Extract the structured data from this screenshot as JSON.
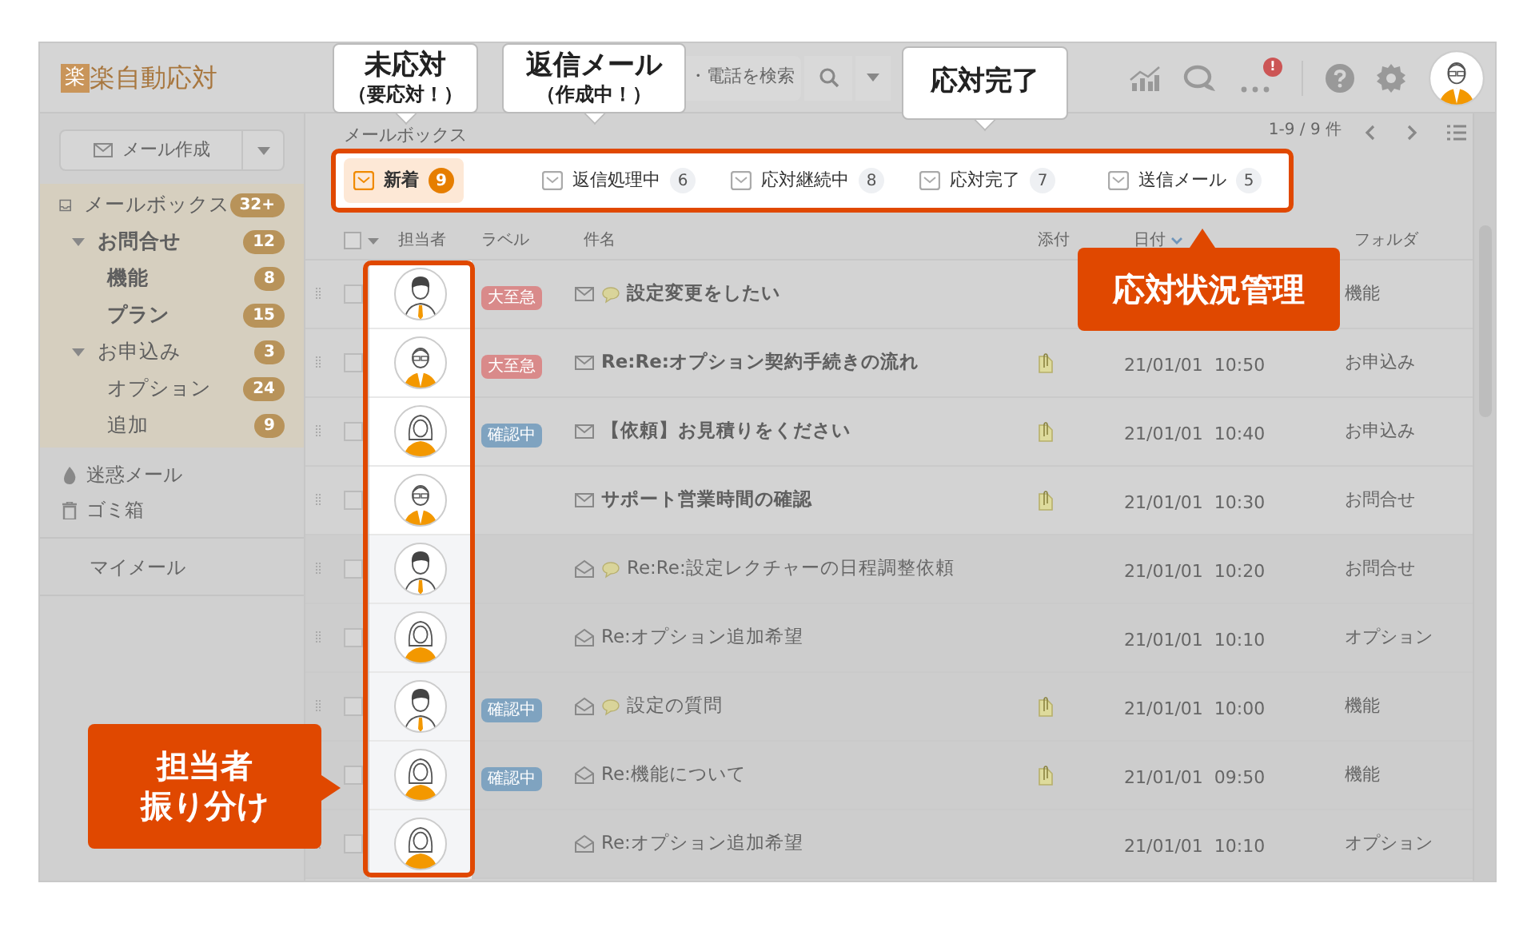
{
  "header": {
    "logo_mark": "楽",
    "logo_text": "楽自動応対",
    "search_visible_text": "・電話を検索",
    "alert_badge": "!"
  },
  "sidebar": {
    "compose_button": "メール作成",
    "tree": [
      {
        "label": "メールボックス",
        "count": "32+",
        "bold": false,
        "children": [
          {
            "label": "お問合せ",
            "count": "12",
            "bold": true,
            "expanded": true,
            "children": [
              {
                "label": "機能",
                "count": "8",
                "bold": true
              },
              {
                "label": "プラン",
                "count": "15",
                "bold": true
              }
            ]
          },
          {
            "label": "お申込み",
            "count": "3",
            "bold": false,
            "expanded": true,
            "children": [
              {
                "label": "オプション",
                "count": "24",
                "bold": false
              },
              {
                "label": "追加",
                "count": "9",
                "bold": false
              }
            ]
          }
        ]
      }
    ],
    "other_items": [
      {
        "label": "迷惑メール",
        "kind": "spam"
      },
      {
        "label": "ゴミ箱",
        "kind": "trash"
      }
    ],
    "my_mail": "マイメール"
  },
  "main": {
    "section_title": "メールボックス",
    "pagination": "1-9 / 9 件",
    "tabs": [
      {
        "label": "新着",
        "count": "9",
        "selected": true
      },
      {
        "label": "返信処理中",
        "count": "6",
        "selected": false
      },
      {
        "label": "応対継続中",
        "count": "8",
        "selected": false
      },
      {
        "label": "応対完了",
        "count": "7",
        "selected": false
      },
      {
        "label": "送信メール",
        "count": "5",
        "selected": false
      }
    ],
    "table": {
      "select_all_checked": false,
      "columns": [
        "担当者",
        "ラベル",
        "件名",
        "添付",
        "日付",
        "フォルダ"
      ],
      "rows": [
        {
          "assignee": {
            "kind": "man"
          },
          "label": {
            "text": "大至急",
            "color": "#d98a8a"
          },
          "opened": false,
          "comment": true,
          "unread": true,
          "subject": "設定変更をしたい",
          "attachment": false,
          "folder": "機能"
        },
        {
          "assignee": {
            "kind": "man-glasses"
          },
          "label": {
            "text": "大至急",
            "color": "#d98a8a"
          },
          "opened": false,
          "comment": false,
          "unread": true,
          "subject": "Re:Re:オプション契約手続きの流れ",
          "attachment": true,
          "date": "21/01/01  10:50",
          "folder": "お申込み"
        },
        {
          "assignee": {
            "kind": "woman"
          },
          "label": {
            "text": "確認中",
            "color": "#7fa3c0"
          },
          "opened": false,
          "comment": false,
          "unread": true,
          "subject": "【依頼】お見積りをください",
          "attachment": true,
          "date": "21/01/01  10:40",
          "folder": "お申込み"
        },
        {
          "assignee": {
            "kind": "man-glasses"
          },
          "opened": false,
          "comment": false,
          "unread": true,
          "subject": "サポート営業時間の確認",
          "attachment": true,
          "date": "21/01/01  10:30",
          "folder": "お問合せ"
        },
        {
          "assignee": {
            "kind": "man"
          },
          "opened": true,
          "comment": true,
          "unread": false,
          "subject": "Re:Re:設定レクチャーの日程調整依頼",
          "attachment": false,
          "date": "21/01/01  10:20",
          "folder": "お問合せ"
        },
        {
          "assignee": {
            "kind": "woman"
          },
          "opened": true,
          "comment": false,
          "unread": false,
          "subject": "Re:オプション追加希望",
          "attachment": false,
          "date": "21/01/01  10:10",
          "folder": "オプション"
        },
        {
          "assignee": {
            "kind": "man"
          },
          "label": {
            "text": "確認中",
            "color": "#7fa3c0"
          },
          "opened": true,
          "comment": true,
          "unread": false,
          "subject": "設定の質問",
          "attachment": true,
          "date": "21/01/01  10:00",
          "folder": "機能"
        },
        {
          "assignee": {
            "kind": "woman"
          },
          "label": {
            "text": "確認中",
            "color": "#7fa3c0"
          },
          "opened": true,
          "comment": false,
          "unread": false,
          "subject": "Re:機能について",
          "attachment": true,
          "date": "21/01/01  09:50",
          "folder": "機能"
        },
        {
          "assignee": {
            "kind": "woman"
          },
          "opened": true,
          "comment": false,
          "unread": false,
          "subject": "Re:オプション追加希望",
          "attachment": false,
          "date": "21/01/01  10:10",
          "folder": "オプション"
        }
      ]
    }
  },
  "callouts": [
    {
      "kind": "bubble",
      "title": "未応対",
      "subtitle": "（要応対！）"
    },
    {
      "kind": "bubble",
      "title": "返信メール",
      "subtitle": "（作成中！）"
    },
    {
      "kind": "bubble",
      "title": "応対完了"
    },
    {
      "kind": "tag",
      "title": "応対状況管理"
    },
    {
      "kind": "tag-side",
      "title": "担当者",
      "subtitle": "振り分け"
    }
  ]
}
